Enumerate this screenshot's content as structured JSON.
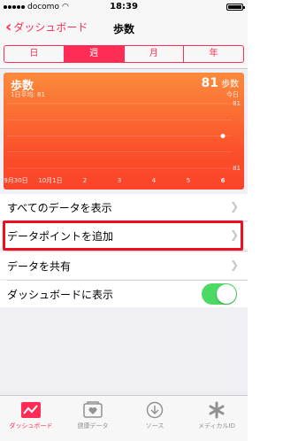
{
  "status": {
    "carrier": "docomo",
    "time": "18:39"
  },
  "nav": {
    "back_label": "ダッシュボード",
    "title": "歩数"
  },
  "segments": [
    "日",
    "週",
    "月",
    "年"
  ],
  "chart_data": {
    "type": "line",
    "title": "歩数",
    "subtitle": "1日平均: 81",
    "total": "81",
    "total_unit": "歩数",
    "period": "今日",
    "categories": [
      "9月30日",
      "10月1日",
      "2",
      "3",
      "4",
      "5",
      "6"
    ],
    "values": [
      null,
      null,
      null,
      null,
      null,
      null,
      81
    ],
    "y_labels": [
      "81",
      "81"
    ],
    "ylim": [
      80,
      82
    ],
    "grid": true,
    "accent_color": "#fb5a2e"
  },
  "rows": {
    "show_all": "すべてのデータを表示",
    "add_point": "データポイントを追加",
    "share": "データを共有",
    "dashboard": "ダッシュボードに表示"
  },
  "toggle_on": true,
  "tabs": [
    {
      "label": "ダッシュボード",
      "icon": "dashboard-icon"
    },
    {
      "label": "健康データ",
      "icon": "health-data-icon"
    },
    {
      "label": "ソース",
      "icon": "sources-icon"
    },
    {
      "label": "メディカルID",
      "icon": "medical-id-icon"
    }
  ],
  "colors": {
    "accent": "#ff2d55",
    "switch": "#4cd964",
    "highlight": "#ee1020"
  }
}
